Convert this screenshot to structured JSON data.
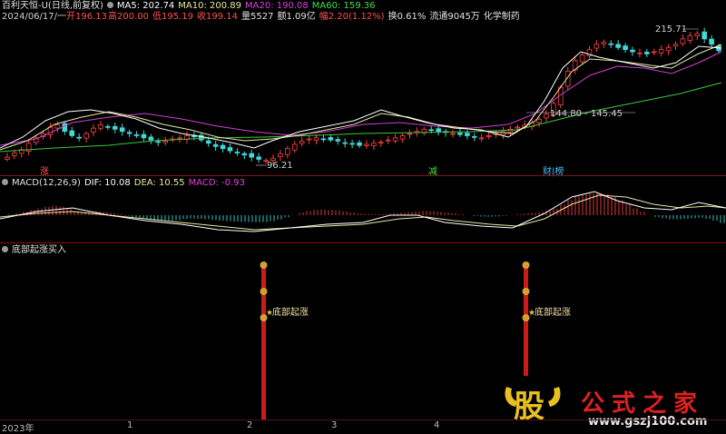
{
  "header": {
    "title": "百利天恒-U(日线,前复权)",
    "ma5": "MA5: 202.74",
    "ma10": "MA10: 200.89",
    "ma20": "MA20: 190.08",
    "ma60": "MA60: 159.36",
    "colors": {
      "ma5": "#ffffff",
      "ma10": "#e8e8a0",
      "ma20": "#e040e0",
      "ma60": "#40e040"
    }
  },
  "info": {
    "date": "2024/06/17/一",
    "open": "开196.13",
    "high": "高200.00",
    "low": "低195.19",
    "close": "收199.14",
    "volume": "量5527",
    "amount": "额1.09亿",
    "change": "幅2.20(1.12%)",
    "turnover": "换0.61%",
    "float": "流通9045万",
    "sector": "化学制药"
  },
  "price_labels": {
    "high": "215.71",
    "low": "96.21",
    "support": "144.80 - 145.45"
  },
  "markers": {
    "zhang": "涨",
    "jian": "减",
    "caibao": "财|榜"
  },
  "macd": {
    "title": "MACD(12,26,9)",
    "dif": "DIF: 10.08",
    "dea": "DEA: 10.55",
    "macd": "MACD: -0.93"
  },
  "indicator": {
    "title": "底部起涨买入",
    "label1": "底部起涨",
    "label2": "底部起涨"
  },
  "xaxis": [
    "2023年",
    "1",
    "2",
    "3",
    "4"
  ],
  "watermark": {
    "logo": "股",
    "name": "公式之家",
    "url": "www.gszj100.com"
  },
  "chart_data": [
    {
      "type": "candlestick",
      "title": "百利天恒-U(日线,前复权)",
      "series": [
        {
          "name": "MA5",
          "color": "#ffffff"
        },
        {
          "name": "MA10",
          "color": "#e8e8a0"
        },
        {
          "name": "MA20",
          "color": "#e040e0"
        },
        {
          "name": "MA60",
          "color": "#40e040"
        }
      ],
      "approx_close": [
        100,
        104,
        107,
        113,
        118,
        122,
        128,
        130,
        124,
        120,
        118,
        122,
        127,
        130,
        128,
        126,
        124,
        122,
        120,
        118,
        116,
        114,
        115,
        117,
        118,
        120,
        119,
        116,
        113,
        110,
        108,
        106,
        104,
        102,
        100,
        98,
        97,
        99,
        103,
        108,
        112,
        115,
        117,
        118,
        117,
        116,
        115,
        113,
        112,
        111,
        112,
        113,
        114,
        116,
        118,
        120,
        122,
        124,
        126,
        125,
        124,
        123,
        122,
        121,
        120,
        119,
        118,
        120,
        122,
        124,
        126,
        128,
        130,
        132,
        135,
        140,
        150,
        165,
        180,
        190,
        195,
        200,
        205,
        207,
        205,
        202,
        200,
        198,
        197,
        196,
        198,
        200,
        202,
        205,
        210,
        213,
        215,
        210,
        205,
        199
      ],
      "marked_high": 215.71,
      "marked_low": 96.21,
      "support_range": [
        144.8,
        145.45
      ]
    },
    {
      "type": "line",
      "title": "MACD(12,26,9)",
      "series": [
        {
          "name": "DIF",
          "value": 10.08
        },
        {
          "name": "DEA",
          "value": 10.55
        },
        {
          "name": "MACD",
          "value": -0.93
        }
      ]
    },
    {
      "type": "bar",
      "title": "底部起涨买入",
      "signals": [
        {
          "index": 42,
          "label": "底部起涨"
        },
        {
          "index": 86,
          "label": "底部起涨"
        }
      ]
    }
  ]
}
